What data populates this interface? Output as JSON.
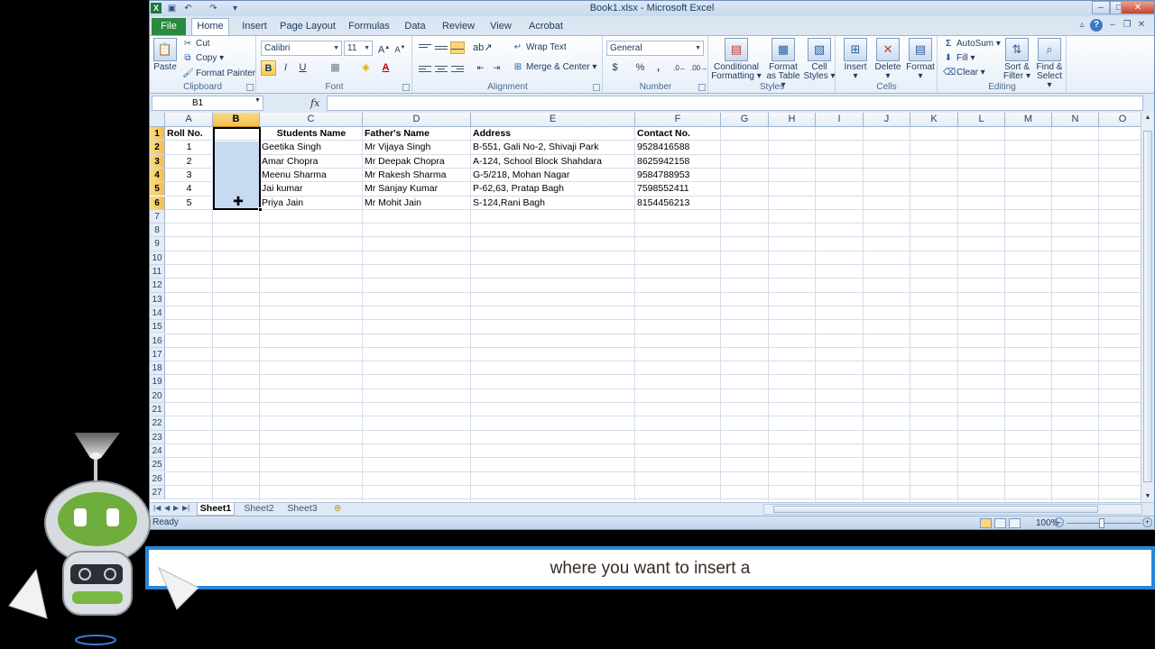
{
  "window": {
    "title": "Book1.xlsx - Microsoft Excel",
    "controls": [
      "–",
      "□",
      "✕"
    ]
  },
  "ribbon": {
    "file_tab": "File",
    "tabs": [
      "Home",
      "Insert",
      "Page Layout",
      "Formulas",
      "Data",
      "Review",
      "View",
      "Acrobat"
    ],
    "active_tab": "Home",
    "clipboard": {
      "paste": "Paste",
      "cut": "Cut",
      "copy": "Copy",
      "format_painter": "Format Painter",
      "label": "Clipboard"
    },
    "font": {
      "name": "Calibri",
      "size": "11",
      "bold": "B",
      "italic": "I",
      "underline": "U",
      "label": "Font"
    },
    "alignment": {
      "wrap_text": "Wrap Text",
      "merge_center": "Merge & Center",
      "label": "Alignment"
    },
    "number": {
      "format": "General",
      "currency": "$",
      "percent": "%",
      "comma": ",",
      "label": "Number"
    },
    "styles": {
      "conditional_line1": "Conditional",
      "conditional_line2": "Formatting",
      "format_table_line1": "Format",
      "format_table_line2": "as Table",
      "cell_styles_line1": "Cell",
      "cell_styles_line2": "Styles",
      "label": "Styles"
    },
    "cells": {
      "insert": "Insert",
      "delete": "Delete",
      "format": "Format",
      "label": "Cells"
    },
    "editing": {
      "autosum": "AutoSum",
      "fill": "Fill",
      "clear": "Clear",
      "sort_line1": "Sort &",
      "sort_line2": "Filter",
      "find_line1": "Find &",
      "find_line2": "Select",
      "label": "Editing"
    }
  },
  "formula_bar": {
    "name_box": "B1",
    "fx": "fx",
    "formula": ""
  },
  "grid": {
    "columns": [
      "A",
      "B",
      "C",
      "D",
      "E",
      "F",
      "G",
      "H",
      "I",
      "J",
      "K",
      "L",
      "M",
      "N",
      "O"
    ],
    "selected_column": "B",
    "rows": [
      "1",
      "2",
      "3",
      "4",
      "5",
      "6",
      "7",
      "8",
      "9",
      "10",
      "11",
      "12",
      "13",
      "14",
      "15",
      "16",
      "17",
      "18",
      "19",
      "20",
      "21",
      "22",
      "23",
      "24",
      "25",
      "26",
      "27"
    ],
    "headers": {
      "a": "Roll No.",
      "b": "",
      "c": "Students Name",
      "d": "Father's Name",
      "e": "Address",
      "f": "Contact No."
    },
    "data": [
      {
        "a": "1",
        "c": "Geetika Singh",
        "d": "Mr Vijaya Singh",
        "e": "B-551, Gali No-2, Shivaji Park",
        "f": "9528416588"
      },
      {
        "a": "2",
        "c": "Amar Chopra",
        "d": "Mr Deepak Chopra",
        "e": "A-124, School Block Shahdara",
        "f": "8625942158"
      },
      {
        "a": "3",
        "c": "Meenu Sharma",
        "d": "Mr Rakesh Sharma",
        "e": "G-5/218, Mohan Nagar",
        "f": "9584788953"
      },
      {
        "a": "4",
        "c": "Jai kumar",
        "d": "Mr Sanjay Kumar",
        "e": "P-62,63, Pratap Bagh",
        "f": "7598552411"
      },
      {
        "a": "5",
        "c": "Priya Jain",
        "d": "Mr Mohit Jain",
        "e": "S-124,Rani Bagh",
        "f": "8154456213"
      }
    ]
  },
  "sheets": [
    "Sheet1",
    "Sheet2",
    "Sheet3"
  ],
  "active_sheet": "Sheet1",
  "status": {
    "text": "Ready",
    "zoom": "100%"
  },
  "caption": "where you want to insert a",
  "colors": {
    "file_tab": "#2a8a3e",
    "selection_header": "#f3bd4e",
    "selection_fill": "#c6daf2",
    "caption_border": "#2a86d9"
  }
}
